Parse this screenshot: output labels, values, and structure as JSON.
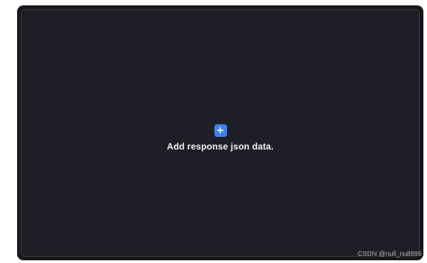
{
  "empty_state": {
    "add_icon": "plus-icon",
    "add_glyph": "+",
    "label": "Add response json data."
  },
  "watermark": {
    "text": "CSDN @null_null999"
  },
  "colors": {
    "window_bg": "#17181b",
    "panel_bg": "#1e1f26",
    "accent": "#3c82f6",
    "label": "#f2f3f5"
  }
}
